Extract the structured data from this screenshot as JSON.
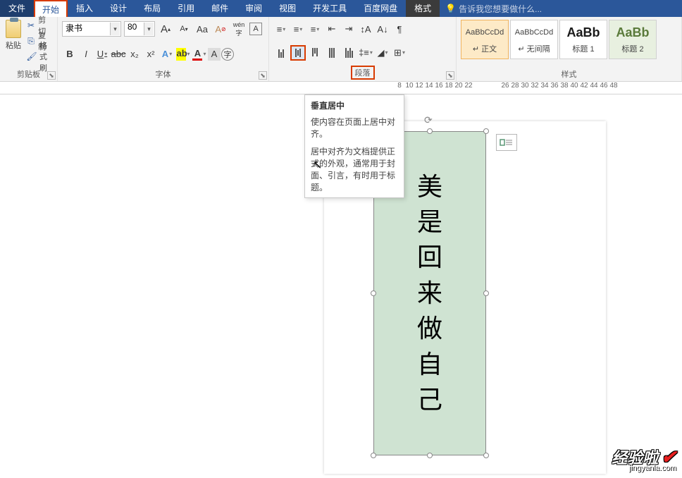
{
  "tabs": {
    "file": "文件",
    "home": "开始",
    "insert": "插入",
    "design": "设计",
    "layout": "布局",
    "references": "引用",
    "mailings": "邮件",
    "review": "审阅",
    "view": "视图",
    "developer": "开发工具",
    "baidu": "百度网盘",
    "format": "格式",
    "tellme": "告诉我您想要做什么..."
  },
  "clipboard": {
    "paste": "粘贴",
    "cut": "剪切",
    "copy": "复制",
    "format_painter": "格式刷",
    "group_label": "剪贴板"
  },
  "font": {
    "name": "隶书",
    "size": "80",
    "group_label": "字体",
    "grow": "A",
    "shrink": "A",
    "case": "Aa",
    "clear": "A",
    "phonetic": "wén",
    "enclose": "字",
    "bold": "B",
    "italic": "I",
    "underline": "U",
    "strike": "abc",
    "sub": "x₂",
    "sup": "x²",
    "effects": "A",
    "highlight": "ab",
    "color": "A",
    "char_shade": "A",
    "border": "A"
  },
  "paragraph": {
    "group_label": "段落"
  },
  "styles": {
    "group_label": "样式",
    "s1_prev": "AaBbCcDd",
    "s1_name": "↵ 正文",
    "s2_prev": "AaBbCcDd",
    "s2_name": "↵ 无间隔",
    "s3_prev": "AaBb",
    "s3_name": "标题 1",
    "s4_prev": "AaBb",
    "s4_name": "标题 2"
  },
  "ruler": {
    "seg1": [
      "8",
      "10",
      "12",
      "14",
      "16",
      "18",
      "20",
      "22"
    ],
    "seg2": [
      "26",
      "28",
      "30",
      "32",
      "34",
      "36",
      "38",
      "40",
      "42",
      "44",
      "46",
      "48"
    ]
  },
  "tooltip": {
    "title": "垂直居中",
    "line1": "使内容在页面上居中对齐。",
    "line2": "居中对齐为文档提供正式的外观，通常用于封面、引言，有时用于标题。"
  },
  "textbox": {
    "c1": "美",
    "c2": "是",
    "c3": "回",
    "c4": "来",
    "c5": "做",
    "c6": "自",
    "c7": "己"
  },
  "watermark": {
    "main": "经验啦",
    "sub": "jingyanla.com"
  }
}
